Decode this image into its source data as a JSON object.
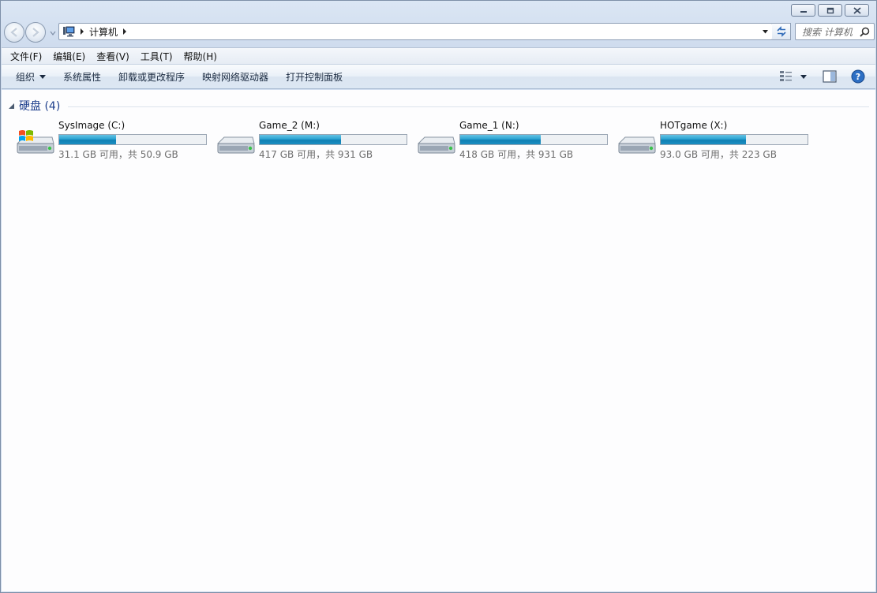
{
  "address": {
    "path": "计算机",
    "search_placeholder": "搜索 计算机"
  },
  "menu": {
    "items": [
      {
        "label": "文件(F)"
      },
      {
        "label": "编辑(E)"
      },
      {
        "label": "查看(V)"
      },
      {
        "label": "工具(T)"
      },
      {
        "label": "帮助(H)"
      }
    ]
  },
  "toolbar": {
    "organize_label": "组织",
    "system_properties_label": "系统属性",
    "uninstall_label": "卸载或更改程序",
    "map_drive_label": "映射网络驱动器",
    "control_panel_label": "打开控制面板"
  },
  "group": {
    "title": "硬盘 (4)"
  },
  "drives": [
    {
      "name": "SysImage (C:)",
      "space": "31.1 GB 可用，共 50.9 GB",
      "used_fraction": 0.389,
      "icon": "system-drive-icon"
    },
    {
      "name": "Game_2 (M:)",
      "space": "417 GB 可用，共 931 GB",
      "used_fraction": 0.552,
      "icon": "hard-drive-icon"
    },
    {
      "name": "Game_1 (N:)",
      "space": "418 GB 可用，共 931 GB",
      "used_fraction": 0.551,
      "icon": "hard-drive-icon"
    },
    {
      "name": "HOTgame (X:)",
      "space": "93.0 GB 可用，共 223 GB",
      "used_fraction": 0.583,
      "icon": "hard-drive-icon"
    }
  ],
  "colors": {
    "bar_fill": "#1b8fc2",
    "group_title": "#1e3f8c"
  }
}
